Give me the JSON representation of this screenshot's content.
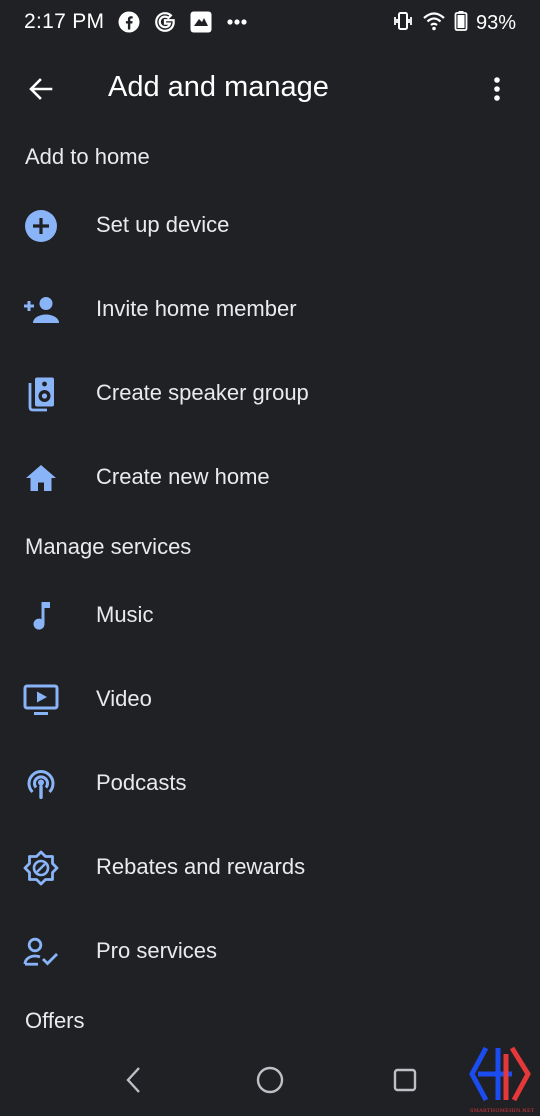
{
  "status_bar": {
    "time": "2:17 PM",
    "battery": "93%",
    "left_icons": [
      "facebook-icon",
      "google-icon",
      "app-notification-icon",
      "more-notifications-icon"
    ],
    "right_icons": [
      "vibrate-icon",
      "wifi-icon",
      "battery-icon"
    ]
  },
  "app_bar": {
    "title": "Add and manage",
    "back_icon": "arrow-back-icon",
    "menu_icon": "more-vert-icon"
  },
  "sections": {
    "add_to_home": {
      "header": "Add to home",
      "items": [
        {
          "label": "Set up device",
          "icon": "add-circle-icon"
        },
        {
          "label": "Invite home member",
          "icon": "person-add-icon"
        },
        {
          "label": "Create speaker group",
          "icon": "speaker-icon"
        },
        {
          "label": "Create new home",
          "icon": "home-icon"
        }
      ]
    },
    "manage_services": {
      "header": "Manage services",
      "items": [
        {
          "label": "Music",
          "icon": "music-note-icon"
        },
        {
          "label": "Video",
          "icon": "video-icon"
        },
        {
          "label": "Podcasts",
          "icon": "podcast-icon"
        },
        {
          "label": "Rebates and rewards",
          "icon": "rewards-badge-icon"
        },
        {
          "label": "Pro services",
          "icon": "person-check-icon"
        }
      ]
    },
    "offers": {
      "header": "Offers"
    }
  },
  "nav_bar": {
    "icons": [
      "nav-back-icon",
      "nav-home-icon",
      "nav-recents-icon"
    ]
  },
  "watermark": {
    "text": "SMARTHOMEHIN.NET"
  },
  "colors": {
    "background": "#202124",
    "accent_icon": "#8ab4f8",
    "text_primary": "#e8eaed"
  }
}
